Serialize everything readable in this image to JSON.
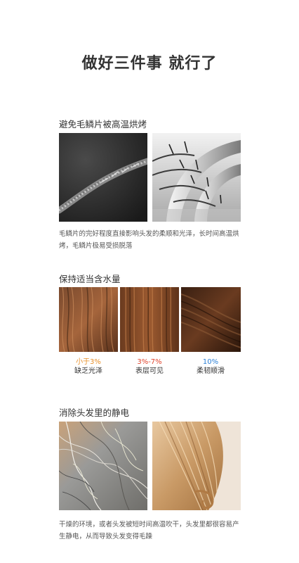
{
  "title": "做好三件事 就行了",
  "section1": {
    "heading": "避免毛鳞片被高温烘烤",
    "description": "毛鳞片的完好程度直接影响头发的柔顺和光泽，长时间高温烘烤，毛鳞片极易受损脱落"
  },
  "section2": {
    "heading": "保持适当含水量",
    "captions": [
      {
        "pct": "小于3%",
        "label": "缺乏光泽",
        "color": "#e8902a"
      },
      {
        "pct": "3%-7%",
        "label": "表层可见",
        "color": "#e0442c"
      },
      {
        "pct": "10%",
        "label": "柔韧顺滑",
        "color": "#2a7fd6"
      }
    ]
  },
  "section3": {
    "heading": "消除头发里的静电",
    "description": "干燥的环境，或者头发被短时间高温吹干，头发里都很容易产生静电，从而导致头发变得毛躁"
  }
}
